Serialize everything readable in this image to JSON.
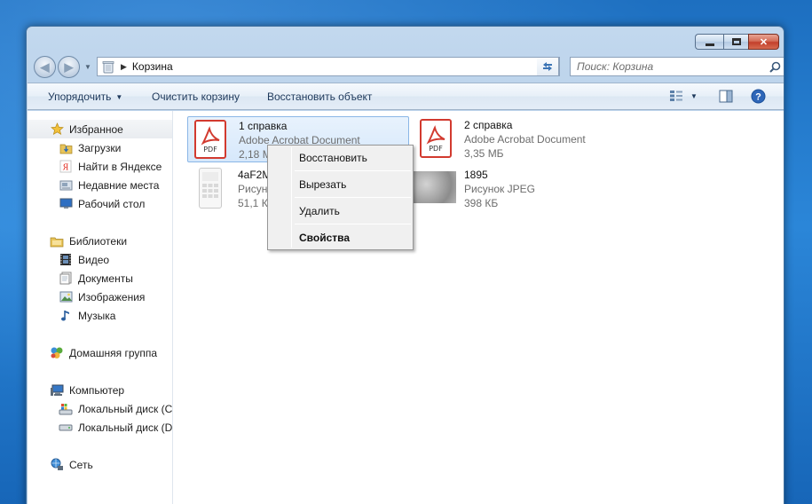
{
  "window": {
    "address": "Корзина",
    "search_placeholder": "Поиск: Корзина"
  },
  "toolbar": {
    "organize_label": "Упорядочить",
    "empty_label": "Очистить корзину",
    "restore_label": "Восстановить объект"
  },
  "sidebar": {
    "favorites": "Избранное",
    "downloads": "Загрузки",
    "yandex": "Найти в Яндексе",
    "recent": "Недавние места",
    "desktop": "Рабочий стол",
    "libraries": "Библиотеки",
    "video": "Видео",
    "documents": "Документы",
    "pictures": "Изображения",
    "music": "Музыка",
    "homegroup": "Домашняя группа",
    "computer": "Компьютер",
    "disk_c": "Локальный диск (C",
    "disk_d": "Локальный диск (D",
    "network": "Сеть"
  },
  "files": [
    {
      "name": "1 справка",
      "type": "Adobe Acrobat Document",
      "size": "2,18 МБ",
      "thumb_label": "PDF"
    },
    {
      "name": "2 справка",
      "type": "Adobe Acrobat Document",
      "size": "3,35 МБ",
      "thumb_label": "PDF"
    },
    {
      "name": "4aF2M",
      "type": "Рисунок",
      "size": "51,1 КБ"
    },
    {
      "name": "1895",
      "type": "Рисунок JPEG",
      "size": "398 КБ"
    }
  ],
  "context_menu": {
    "restore": "Восстановить",
    "cut": "Вырезать",
    "delete": "Удалить",
    "properties": "Свойства"
  },
  "colors": {
    "pdf_red": "#d23a2f",
    "selection": "#d6e8fb",
    "desktop_blue": "#2b86d8"
  }
}
